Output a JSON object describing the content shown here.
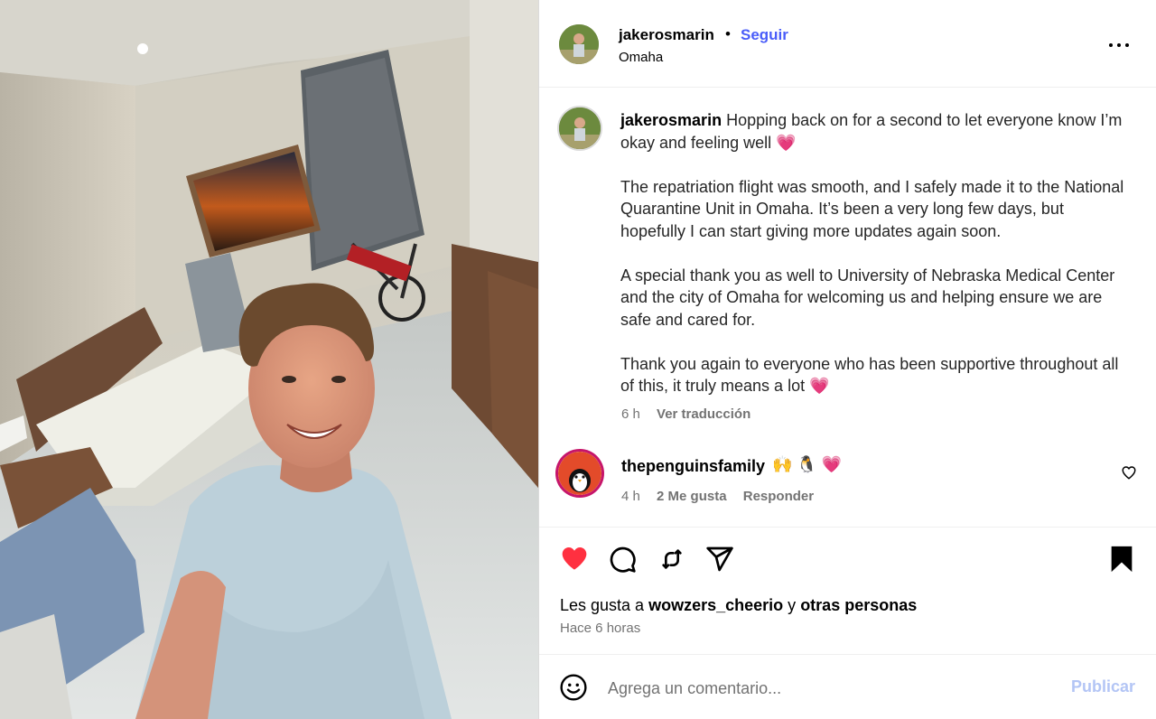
{
  "post": {
    "username": "jakerosmarin",
    "separator": "•",
    "follow_label": "Seguir",
    "location": "Omaha",
    "more_icon": "more-options-icon"
  },
  "caption": {
    "username": "jakerosmarin",
    "paragraph_1": "Hopping back on for a second to let everyone know I’m okay and feeling well",
    "paragraph_1_emoji": "💗",
    "paragraph_2": "The repatriation flight was smooth, and I safely made it to the National Quarantine Unit in Omaha. It’s been a very long few days, but hopefully I can start giving more updates again soon.",
    "paragraph_3": "A special thank you as well to University of Nebraska Medical Center and the city of Omaha for welcoming us and helping ensure we are safe and cared for.",
    "paragraph_4": "Thank you again to everyone who has been supportive throughout all of this, it truly means a lot",
    "paragraph_4_emoji": "💗",
    "time": "6 h",
    "translate_label": "Ver traducción"
  },
  "comment": {
    "username": "thepenguinsfamily",
    "emojis": "🙌 🐧 💗",
    "time": "4 h",
    "likes": "2 Me gusta",
    "reply_label": "Responder",
    "like_icon": "heart-outline-icon"
  },
  "actions": {
    "like_icon": "heart-filled-icon",
    "comment_icon": "comment-icon",
    "repost_icon": "repost-icon",
    "share_icon": "send-icon",
    "save_icon": "bookmark-filled-icon"
  },
  "likes": {
    "prefix": "Les gusta a",
    "user": "wowzers_cheerio",
    "connector": "y",
    "others": "otras personas"
  },
  "time_ago": "Hace 6 horas",
  "composer": {
    "emoji_icon": "smiley-icon",
    "placeholder": "Agrega un comentario...",
    "publish_label": "Publicar"
  },
  "colors": {
    "accent": "#4a5df9",
    "like_red": "#ff3040",
    "publish_disabled": "#b3c5f5",
    "muted": "#737373"
  }
}
